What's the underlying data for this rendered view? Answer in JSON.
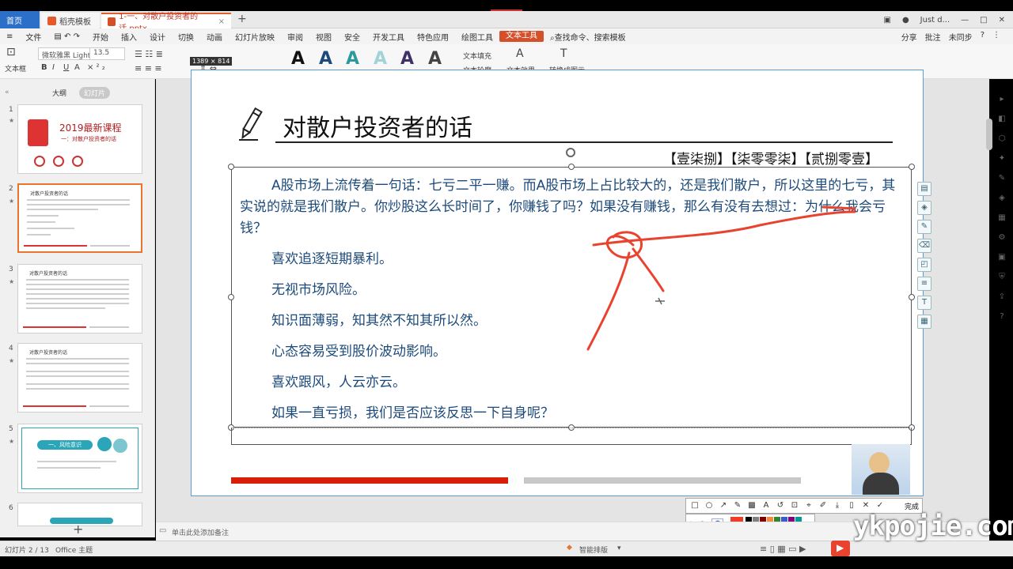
{
  "tabs": {
    "home": "首页",
    "template": "稻壳模板",
    "file": "1-一、对散户投资者的话.pptx",
    "close": "×",
    "plus": "+",
    "user": "Just d..."
  },
  "menu": {
    "items": [
      "文件",
      "开始",
      "插入",
      "设计",
      "切换",
      "动画",
      "幻灯片放映",
      "审阅",
      "视图",
      "安全",
      "开发工具",
      "特色应用",
      "绘图工具",
      "文本工具"
    ],
    "active": "文本工具",
    "search": "查找命令、搜索模板",
    "share": "分享",
    "comment": "批注",
    "sync": "未同步"
  },
  "ribbon": {
    "textbox": "文本框",
    "font": "微软雅黑 Light",
    "size": "13.5",
    "fill": "文本填充",
    "outline": "文本轮廓",
    "effect": "文本效果",
    "convert": "转换成图示",
    "size_tip": "1389 × 814"
  },
  "left_panel": {
    "tab_outline": "大纲",
    "tab_slides": "幻灯片",
    "slides": [
      {
        "num": "1",
        "title": "2019最新课程",
        "sub": "一：对散户投资者的话"
      },
      {
        "num": "2",
        "title": "对散户投资者的话"
      },
      {
        "num": "3",
        "title": "对散户投资者的话"
      },
      {
        "num": "4",
        "title": "对散户投资者的话"
      },
      {
        "num": "5",
        "title": "一、风险意识"
      },
      {
        "num": "6",
        "title": ""
      }
    ],
    "add": "+"
  },
  "slide": {
    "title": "对散户投资者的话",
    "number_line": "【壹柒捌】【柒零零柒】【贰捌零壹】",
    "paragraph": "A股市场上流传着一句话：七亏二平一赚。而A股市场上占比较大的，还是我们散户，所以这里的七亏，其实说的就是我们散户。你炒股这么长时间了，你赚钱了吗？如果没有赚钱，那么有没有去想过：为什么我会亏钱？",
    "bullets": [
      "喜欢追逐短期暴利。",
      "无视市场风险。",
      "知识面薄弱，知其然不知其所以然。",
      "心态容易受到股价波动影响。",
      "喜欢跟风，人云亦云。",
      "如果一直亏损，我们是否应该反思一下自身呢？"
    ]
  },
  "draw_toolbar": {
    "done": "完成"
  },
  "notes": {
    "placeholder": "单击此处添加备注"
  },
  "status": {
    "slide_index": "幻灯片 2 / 13",
    "theme": "Office 主题",
    "smart": "智能排版"
  },
  "watermark": "ykpojie.com",
  "colors": {
    "accent": "#d4502a",
    "slide_text": "#1c4a7a",
    "red_bar": "#d81e06",
    "annotation": "#e8432e"
  }
}
